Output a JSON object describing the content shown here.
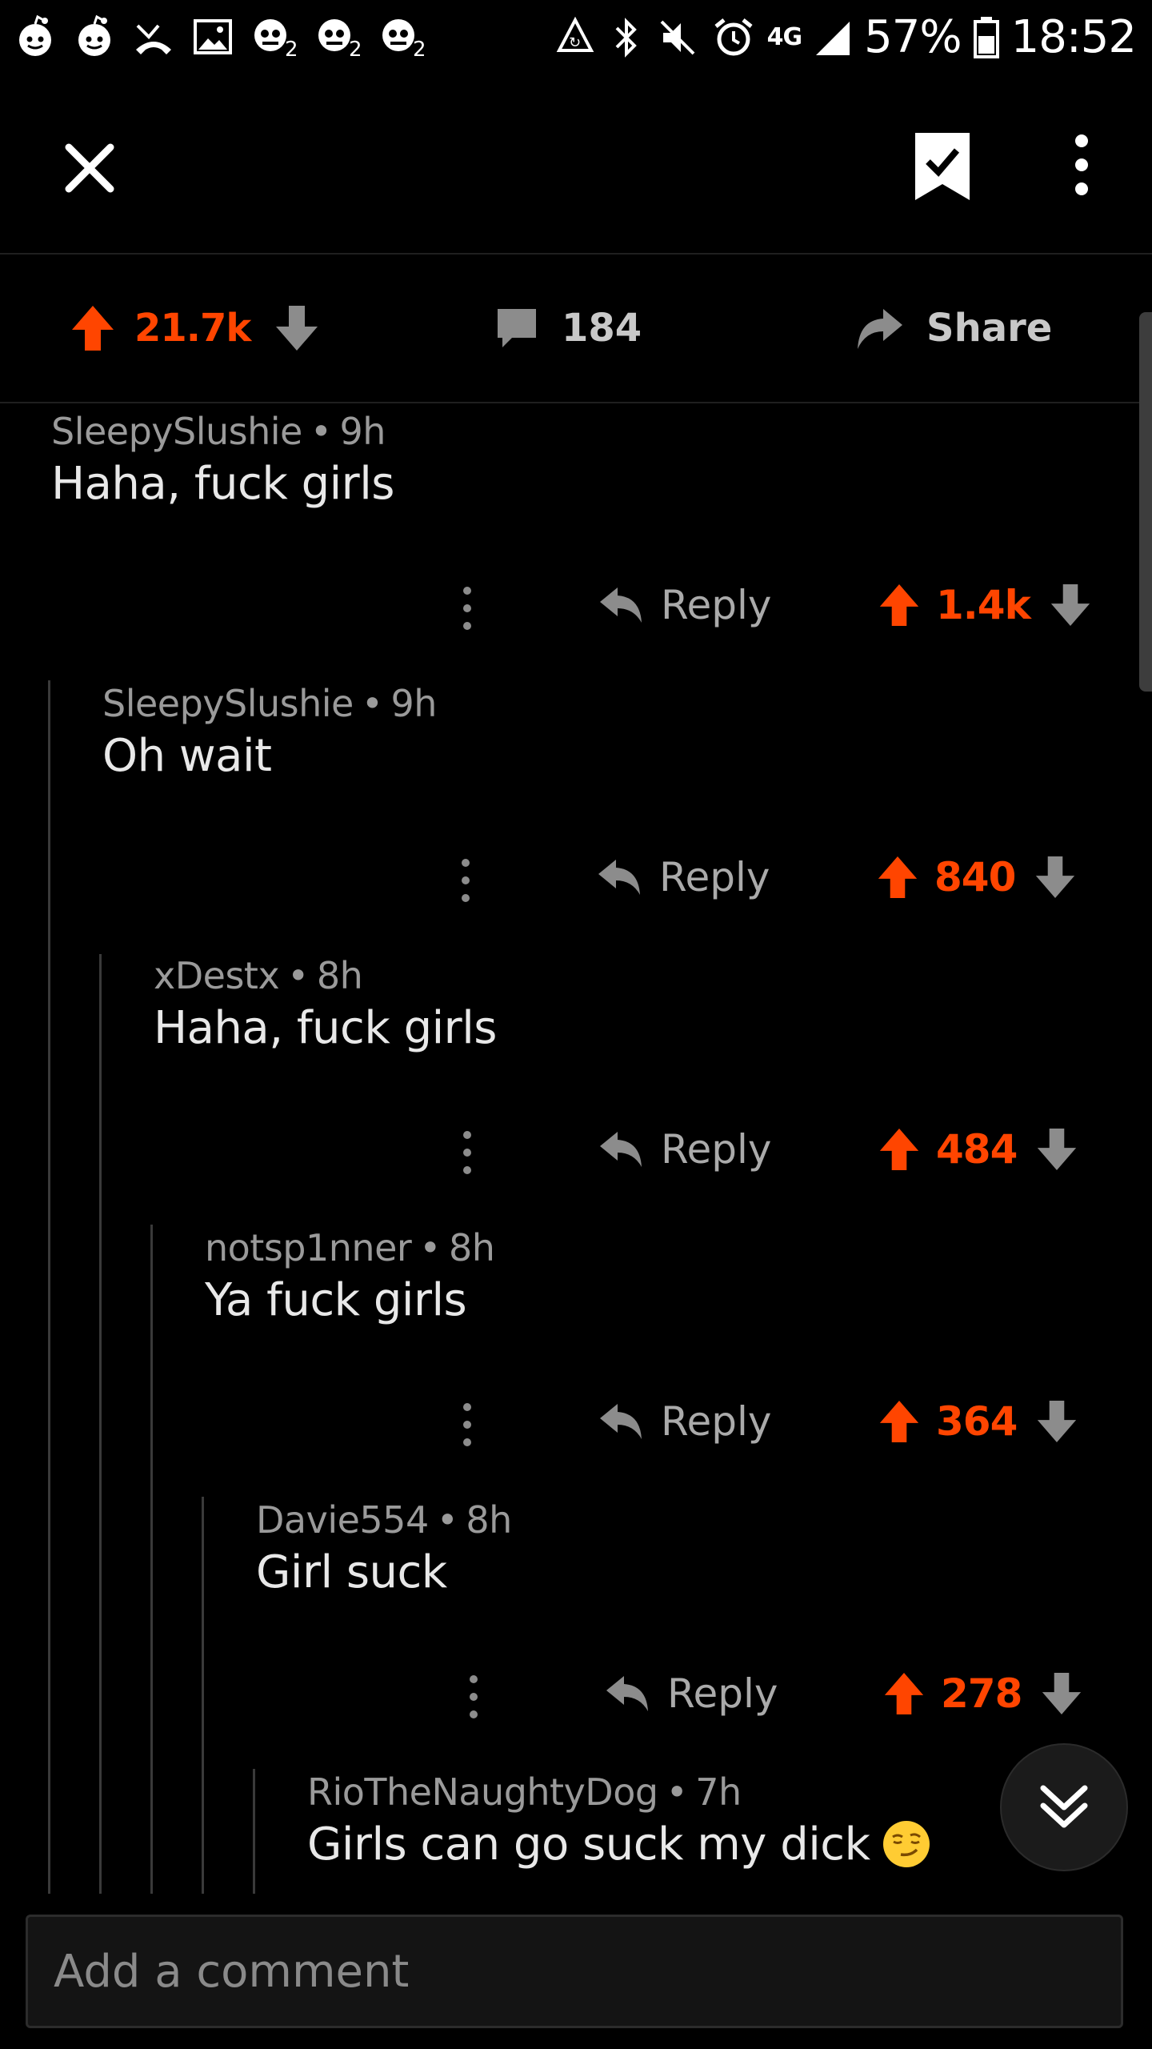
{
  "status_bar": {
    "battery_percent": "57%",
    "time": "18:52",
    "network": "4G"
  },
  "post_actions": {
    "upvotes": "21.7k",
    "comments": "184",
    "share_label": "Share"
  },
  "colors": {
    "accent": "#ff4500",
    "background": "#000000",
    "meta_text": "#9a9a9a",
    "body_text": "#e8e8e8"
  },
  "comments": [
    {
      "author": "SleepySlushie",
      "time": "9h",
      "body": "Haha, fuck girls",
      "score": "1.4k",
      "reply_label": "Reply"
    },
    {
      "author": "SleepySlushie",
      "time": "9h",
      "body": "Oh wait",
      "score": "840",
      "reply_label": "Reply"
    },
    {
      "author": "xDestx",
      "time": "8h",
      "body": "Haha, fuck girls",
      "score": "484",
      "reply_label": "Reply"
    },
    {
      "author": "notsp1nner",
      "time": "8h",
      "body": "Ya fuck girls",
      "score": "364",
      "reply_label": "Reply"
    },
    {
      "author": "Davie554",
      "time": "8h",
      "body": "Girl suck",
      "score": "278",
      "reply_label": "Reply"
    },
    {
      "author": "RioTheNaughtyDog",
      "time": "7h",
      "body": "Girls can go suck my dick"
    }
  ],
  "composer": {
    "placeholder": "Add a comment"
  }
}
